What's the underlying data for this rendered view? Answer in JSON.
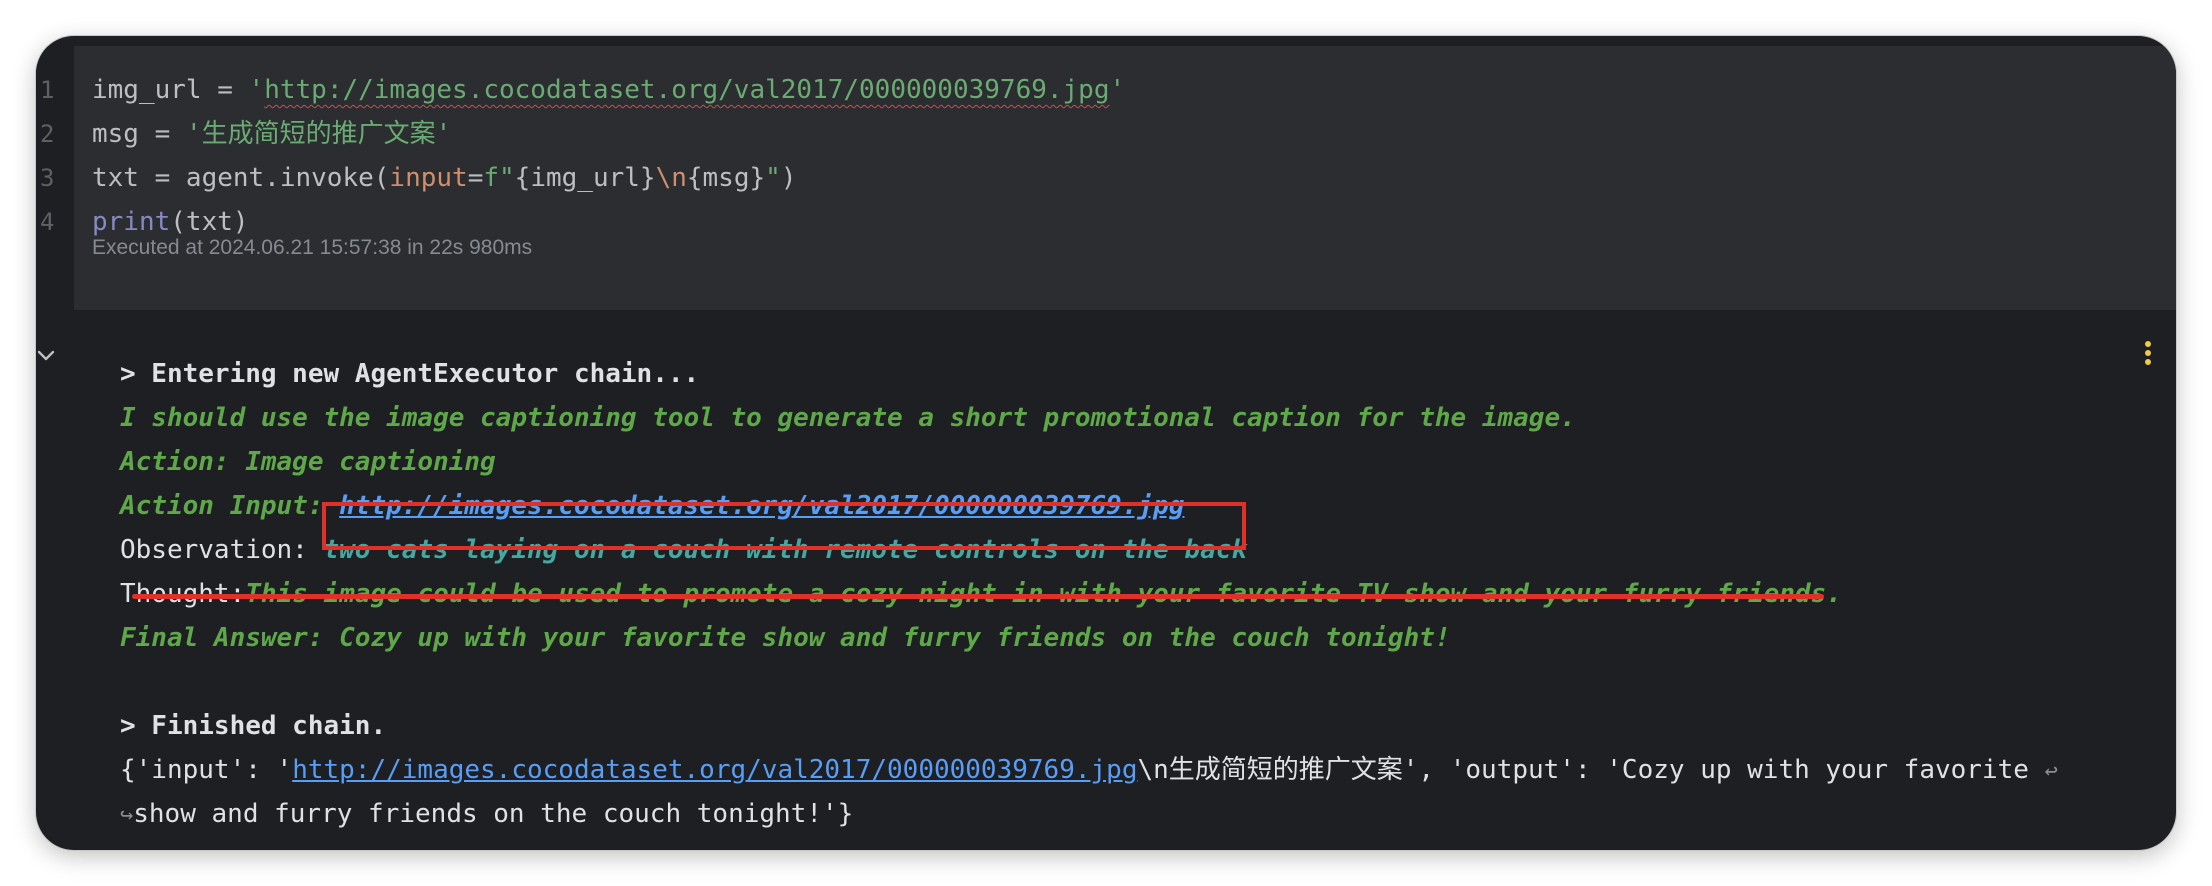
{
  "code": {
    "line_numbers": [
      "1",
      "2",
      "3",
      "4"
    ],
    "line1": {
      "var": "img_url",
      "op": " = ",
      "q1": "'",
      "url": "http://images.cocodataset.org/val2017/000000039769.jpg",
      "q2": "'"
    },
    "line2": {
      "var": "msg",
      "op": " = ",
      "str": "'生成简短的推广文案'"
    },
    "line3": {
      "pre": "txt = agent.invoke(",
      "kw": "input",
      "eq": "=",
      "fstart": "f\"",
      "ph1": "{img_url}",
      "esc": "\\n",
      "ph2": "{msg}",
      "fend": "\"",
      "close": ")"
    },
    "line4": {
      "fn": "print",
      "arg": "(txt)"
    },
    "executed": "Executed at 2024.06.21 15:57:38 in 22s 980ms"
  },
  "output": {
    "entering": "> Entering new AgentExecutor chain...",
    "thought1": "I should use the image captioning tool to generate a short promotional caption for the image.",
    "action": "Action: Image captioning",
    "action_input_label": "Action Input: ",
    "action_input_url": "http://images.cocodataset.org/val2017/000000039769.jpg",
    "observation_label": "Observation: ",
    "observation_text": "two cats laying on a couch with remote controls on the back",
    "thought_label": "Thought:",
    "thought_text": "This image could be used to promote a cozy night in with your favorite TV show and your furry friends.",
    "final_answer": "Final Answer: Cozy up with your favorite show and furry friends on the couch tonight!",
    "finished": "> Finished chain.",
    "result_prefix": "{'input': '",
    "result_url": "http://images.cocodataset.org/val2017/000000039769.jpg",
    "result_mid": "\\n生成简短的推广文案', 'output': 'Cozy up with your favorite ",
    "result_wrap_mark": "↩",
    "result_line2_mark": "↪",
    "result_line2": "show and furry friends on the couch tonight!'}"
  },
  "colors": {
    "background": "#1e1f22",
    "code_cell": "#2b2d30",
    "annotation_red": "#e0302a",
    "agent_green": "#5fa84a",
    "link_blue": "#589df6",
    "observation_cyan": "#43a8a1"
  },
  "icons": {
    "collapse": "chevron-down-icon",
    "menu": "kebab-menu-icon"
  }
}
